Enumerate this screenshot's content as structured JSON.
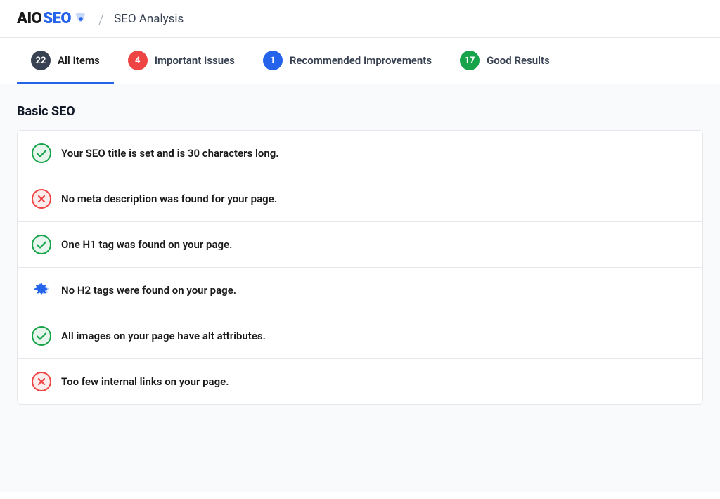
{
  "header": {
    "logo_aio": "AIO",
    "logo_seo": "SEO",
    "divider": "/",
    "title": "SEO Analysis"
  },
  "tabs": [
    {
      "id": "all-items",
      "badge": "22",
      "badge_style": "badge-dark",
      "label": "All Items",
      "active": true
    },
    {
      "id": "important-issues",
      "badge": "4",
      "badge_style": "badge-red",
      "label": "Important Issues",
      "active": false
    },
    {
      "id": "recommended-improvements",
      "badge": "1",
      "badge_style": "badge-blue",
      "label": "Recommended Improvements",
      "active": false
    },
    {
      "id": "good-results",
      "badge": "17",
      "badge_style": "badge-green",
      "label": "Good Results",
      "active": false
    }
  ],
  "section": {
    "title": "Basic SEO"
  },
  "items": [
    {
      "id": "seo-title",
      "icon": "check",
      "text": "Your SEO title is set and is 30 characters long."
    },
    {
      "id": "meta-desc",
      "icon": "error",
      "text": "No meta description was found for your page."
    },
    {
      "id": "h1-tag",
      "icon": "check",
      "text": "One H1 tag was found on your page."
    },
    {
      "id": "h2-tag",
      "icon": "gear",
      "text": "No H2 tags were found on your page."
    },
    {
      "id": "images-alt",
      "icon": "check",
      "text": "All images on your page have alt attributes."
    },
    {
      "id": "internal-links",
      "icon": "error",
      "text": "Too few internal links on your page."
    }
  ]
}
